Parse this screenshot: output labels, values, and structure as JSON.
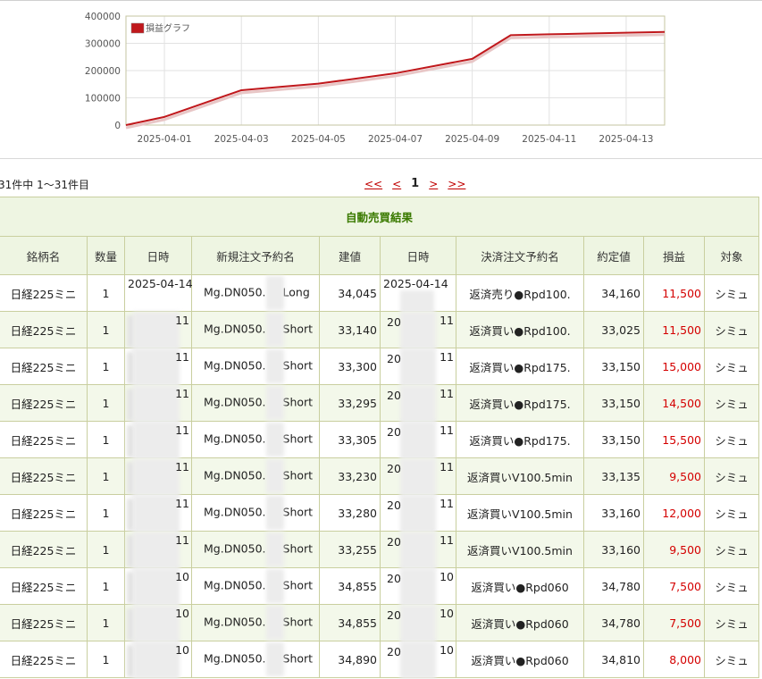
{
  "chart_data": {
    "type": "line",
    "legend": "損益グラフ",
    "x_ticks": [
      "2025-04-01",
      "2025-04-03",
      "2025-04-05",
      "2025-04-07",
      "2025-04-09",
      "2025-04-11",
      "2025-04-13"
    ],
    "y_ticks": [
      "400000",
      "300000",
      "200000",
      "100000",
      "0"
    ],
    "ylim": [
      0,
      400000
    ],
    "x": [
      "2025-03-31",
      "2025-04-01",
      "2025-04-03",
      "2025-04-04",
      "2025-04-05",
      "2025-04-07",
      "2025-04-09",
      "2025-04-10",
      "2025-04-11",
      "2025-04-12",
      "2025-04-13",
      "2025-04-14"
    ],
    "values": [
      0,
      30000,
      128000,
      140000,
      152000,
      190000,
      243000,
      330000,
      333000,
      336000,
      339000,
      342000
    ],
    "line_color": "#c0181c",
    "grid": true,
    "legend_position": "top-left"
  },
  "pagination": {
    "count_text": "31件中 1〜31件目",
    "first": "<<",
    "prev": "<",
    "current": "1",
    "next": ">",
    "last": ">>"
  },
  "table": {
    "title": "自動売買結果",
    "headers": [
      "銘柄名",
      "数量",
      "日時",
      "新規注文予約名",
      "建値",
      "日時",
      "決済注文予約名",
      "約定値",
      "損益",
      "対象"
    ],
    "rows": [
      {
        "name": "日経225ミニ",
        "qty": "1",
        "open_dt": "2025-04-14",
        "open_order": "Mg.DN050.",
        "open_side": "Long",
        "open_price": "34,045",
        "close_dt": "2025-04-14",
        "close_order": "返済売り●Rpd100.",
        "close_price": "34,160",
        "pl": "11,500",
        "target": "シミュ"
      },
      {
        "name": "日経225ミニ",
        "qty": "1",
        "open_dt": "11",
        "open_order": "Mg.DN050.",
        "open_side": "Short",
        "open_price": "33,140",
        "close_dt": "11",
        "close_order": "返済買い●Rpd100.",
        "close_price": "33,025",
        "pl": "11,500",
        "target": "シミュ"
      },
      {
        "name": "日経225ミニ",
        "qty": "1",
        "open_dt": "11",
        "open_order": "Mg.DN050.",
        "open_side": "Short",
        "open_price": "33,300",
        "close_dt": "11",
        "close_order": "返済買い●Rpd175.",
        "close_price": "33,150",
        "pl": "15,000",
        "target": "シミュ"
      },
      {
        "name": "日経225ミニ",
        "qty": "1",
        "open_dt": "11",
        "open_order": "Mg.DN050.",
        "open_side": "Short",
        "open_price": "33,295",
        "close_dt": "11",
        "close_order": "返済買い●Rpd175.",
        "close_price": "33,150",
        "pl": "14,500",
        "target": "シミュ"
      },
      {
        "name": "日経225ミニ",
        "qty": "1",
        "open_dt": "11",
        "open_order": "Mg.DN050.",
        "open_side": "Short",
        "open_price": "33,305",
        "close_dt": "11",
        "close_order": "返済買い●Rpd175.",
        "close_price": "33,150",
        "pl": "15,500",
        "target": "シミュ"
      },
      {
        "name": "日経225ミニ",
        "qty": "1",
        "open_dt": "11",
        "open_order": "Mg.DN050.",
        "open_side": "Short",
        "open_price": "33,230",
        "close_dt": "11",
        "close_order": "返済買いV100.5min",
        "close_price": "33,135",
        "pl": "9,500",
        "target": "シミュ"
      },
      {
        "name": "日経225ミニ",
        "qty": "1",
        "open_dt": "11",
        "open_order": "Mg.DN050.",
        "open_side": "Short",
        "open_price": "33,280",
        "close_dt": "11",
        "close_order": "返済買いV100.5min",
        "close_price": "33,160",
        "pl": "12,000",
        "target": "シミュ"
      },
      {
        "name": "日経225ミニ",
        "qty": "1",
        "open_dt": "11",
        "open_order": "Mg.DN050.",
        "open_side": "Short",
        "open_price": "33,255",
        "close_dt": "11",
        "close_order": "返済買いV100.5min",
        "close_price": "33,160",
        "pl": "9,500",
        "target": "シミュ"
      },
      {
        "name": "日経225ミニ",
        "qty": "1",
        "open_dt": "10",
        "open_order": "Mg.DN050.",
        "open_side": "Short",
        "open_price": "34,855",
        "close_dt": "10",
        "close_order": "返済買い●Rpd060",
        "close_price": "34,780",
        "pl": "7,500",
        "target": "シミュ"
      },
      {
        "name": "日経225ミニ",
        "qty": "1",
        "open_dt": "10",
        "open_order": "Mg.DN050.",
        "open_side": "Short",
        "open_price": "34,855",
        "close_dt": "10",
        "close_order": "返済買い●Rpd060",
        "close_price": "34,780",
        "pl": "7,500",
        "target": "シミュ"
      },
      {
        "name": "日経225ミニ",
        "qty": "1",
        "open_dt": "10",
        "open_order": "Mg.DN050.",
        "open_side": "Short",
        "open_price": "34,890",
        "close_dt": "10",
        "close_order": "返済買い●Rpd060",
        "close_price": "34,810",
        "pl": "8,000",
        "target": "シミュ"
      }
    ]
  },
  "colors": {
    "profit": "#d40000",
    "header_bg": "#eef5e2",
    "title_text": "#3a7a00",
    "link": "#c00000"
  }
}
